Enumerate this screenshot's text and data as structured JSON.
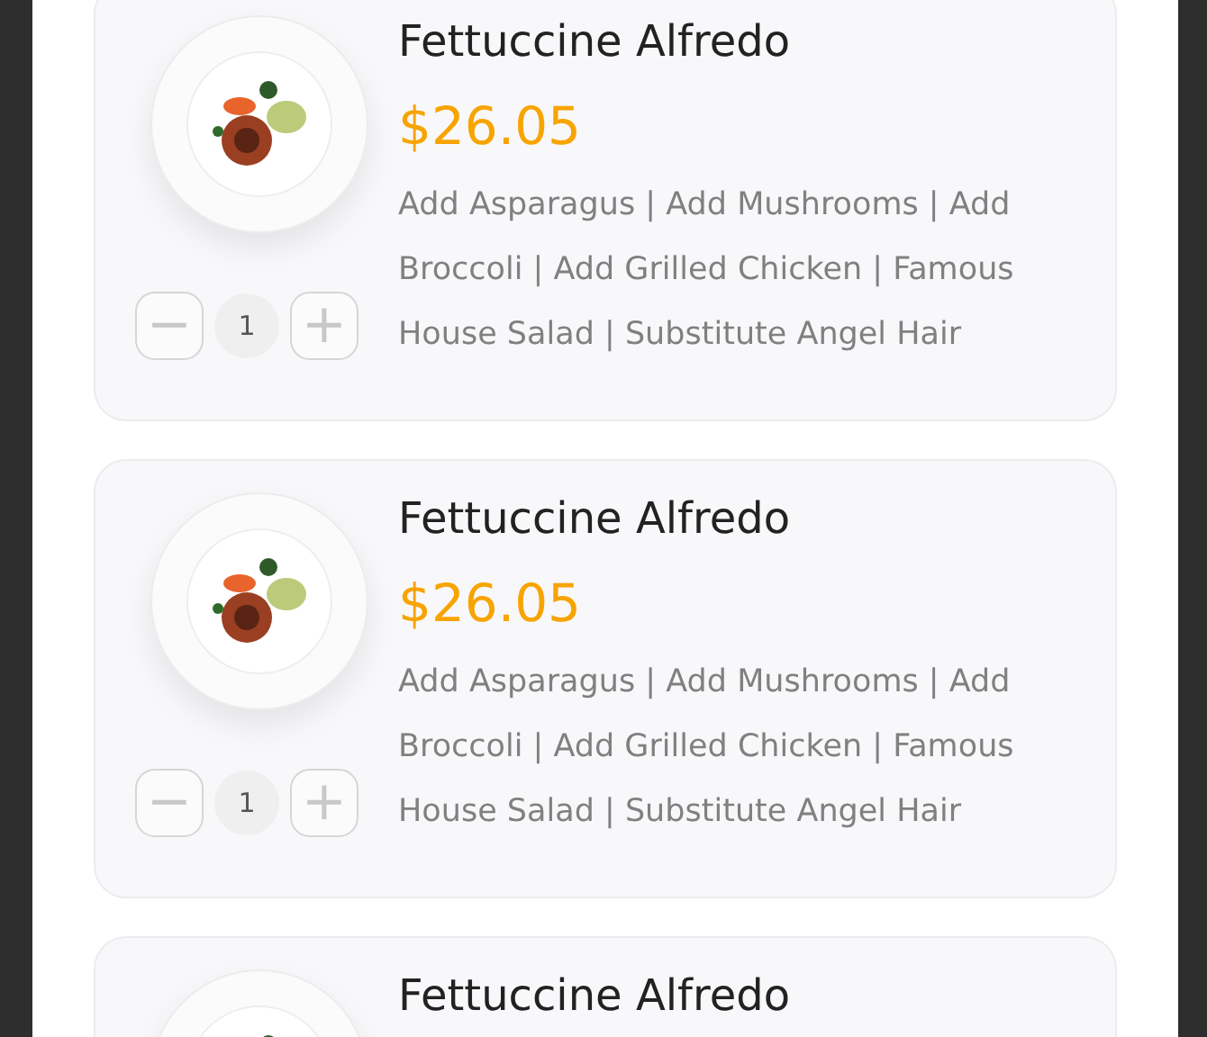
{
  "items": [
    {
      "title": "Fettuccine Alfredo",
      "price": "$26.05",
      "description": "Add Asparagus | Add Mushrooms | Add Broccoli | Add Grilled Chicken | Famous House Salad | Substitute Angel Hair",
      "quantity": "1",
      "minus": "−",
      "plus": "+"
    },
    {
      "title": "Fettuccine Alfredo",
      "price": "$26.05",
      "description": "Add Asparagus | Add Mushrooms | Add Broccoli | Add Grilled Chicken | Famous House Salad | Substitute Angel Hair",
      "quantity": "1",
      "minus": "−",
      "plus": "+"
    },
    {
      "title": "Fettuccine Alfredo"
    }
  ]
}
